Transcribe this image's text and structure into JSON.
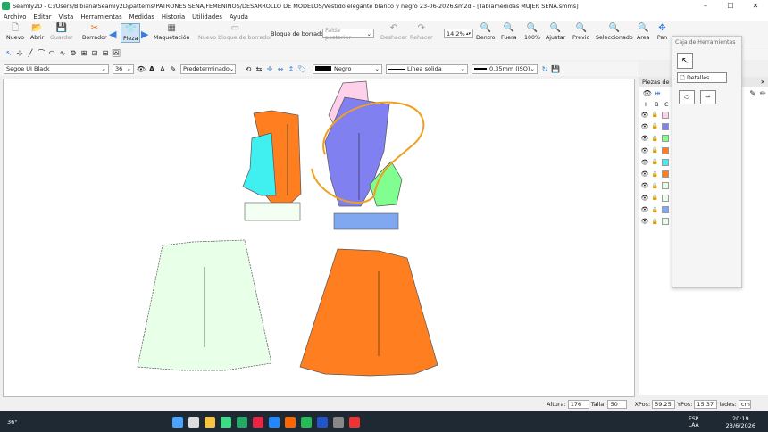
{
  "title": "Seamly2D - C:/Users/Bibiana/Seamly2D/patterns/PATRONES SENA/FEMENINOS/DESARROLLO DE MODELOS/Vestido elegante blanco y negro 23-06-2026.sm2d - [Tablamedidas MUJER SENA.smms]",
  "menu": [
    "Archivo",
    "Editar",
    "Vista",
    "Herramientas",
    "Medidas",
    "Historia",
    "Utilidades",
    "Ayuda"
  ],
  "toolbar": {
    "nuevo": "Nuevo",
    "abrir": "Abrir",
    "guardar": "Guardar",
    "borrador": "Borrador",
    "pieza": "Pieza",
    "maquetacion": "Maquetación",
    "nuevo_bloque": "Nuevo bloque de borrador",
    "bloque_label": "Bloque de borrador:",
    "bloque_value": "Falda posterior",
    "deshacer": "Deshacer",
    "rehacer": "Rehacer",
    "zoom": "14.2%",
    "dentro": "Dentro",
    "fuera": "Fuera",
    "p100": "100%",
    "ajustar": "Ajustar",
    "previo": "Previo",
    "seleccionado": "Seleccionado",
    "area": "Área",
    "pan": "Pan"
  },
  "format": {
    "font": "Segoe UI Black",
    "size": "36",
    "text_style": "Predeterminado",
    "color": "Negro",
    "line": "Línea sólida",
    "weight": "0.35mm (ISO)"
  },
  "toolbox": {
    "title": "Caja de Herramientas",
    "detalles": "Detalles"
  },
  "pieces_panel": {
    "title": "Piezas de Pa",
    "cols": [
      "I",
      "B",
      "C"
    ],
    "swatches": [
      "#ffd0ea",
      "#8080f0",
      "#80ff90",
      "#ff7f20",
      "#40f0f0",
      "#ff7f20",
      "#e8ffe8",
      "#e8ffe8",
      "#80a8f0",
      "#e8ffe8"
    ]
  },
  "status": {
    "altura_label": "Altura:",
    "altura": "176",
    "talla_label": "Talla:",
    "talla": "50",
    "xpos_label": "XPos:",
    "xpos": "59.25",
    "ypos_label": "YPos:",
    "ypos": "15.37",
    "units_label": "lades:",
    "units": "cm"
  },
  "taskbar": {
    "temp": "36°",
    "lang": "ESP",
    "lang2": "LAA",
    "time": "20:19",
    "date": "23/6/2026"
  },
  "colors": {
    "pink": "#ffd0ea",
    "blue": "#8080f0",
    "green": "#80ff90",
    "orange": "#ff7f20",
    "cyan": "#40f0f0",
    "pale": "#e8ffe8",
    "lightblue": "#80a8f0",
    "curve": "#f0a020"
  }
}
